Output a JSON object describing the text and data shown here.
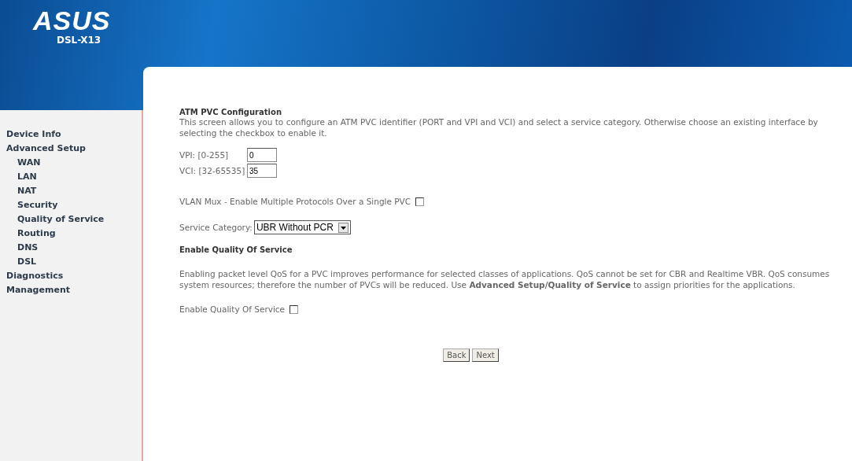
{
  "header": {
    "logo": "ASUS",
    "model": "DSL-X13"
  },
  "sidebar": {
    "items": [
      {
        "label": "Device Info"
      },
      {
        "label": "Advanced Setup",
        "children": [
          {
            "label": "WAN"
          },
          {
            "label": "LAN"
          },
          {
            "label": "NAT"
          },
          {
            "label": "Security"
          },
          {
            "label": "Quality of Service"
          },
          {
            "label": "Routing"
          },
          {
            "label": "DNS"
          },
          {
            "label": "DSL"
          }
        ]
      },
      {
        "label": "Diagnostics"
      },
      {
        "label": "Management"
      }
    ]
  },
  "content": {
    "title": "ATM PVC Configuration",
    "description": "This screen allows you to configure an ATM PVC identifier (PORT and VPI and VCI) and select a service category. Otherwise choose an existing interface by selecting the checkbox to enable it.",
    "fields": [
      {
        "label": "VPI: [0-255]",
        "value": "0"
      },
      {
        "label": "VCI: [32-65535]",
        "value": "35"
      }
    ],
    "vlan_mux": {
      "label": "VLAN Mux - Enable Multiple Protocols Over a Single PVC",
      "checked": false
    },
    "service_category": {
      "label": "Service Category:",
      "value": "UBR Without PCR"
    },
    "qos_heading": "Enable Quality Of Service",
    "qos_text": "Enabling packet level QoS for a PVC improves performance for selected classes of applications.  QoS cannot be set for CBR and Realtime VBR.  QoS consumes system resources; therefore the number of PVCs will be reduced. Use **Advanced Setup/Quality of Service** to assign priorities for the applications.",
    "qos_enable": {
      "label": "Enable Quality Of Service",
      "checked": false
    },
    "buttons": [
      "Back",
      "Next"
    ]
  }
}
